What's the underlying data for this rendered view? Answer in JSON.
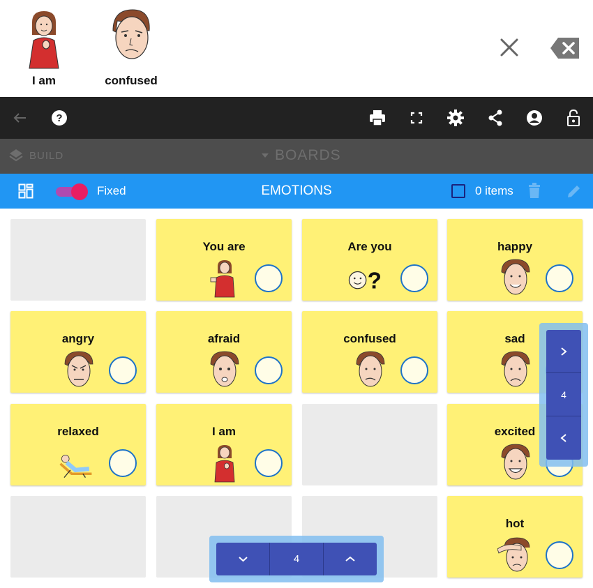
{
  "output": {
    "tiles": [
      {
        "label": "I am"
      },
      {
        "label": "confused"
      }
    ]
  },
  "navbar": {
    "icons": [
      "back-arrow-icon",
      "help-icon",
      "print-icon",
      "fullscreen-icon",
      "settings-icon",
      "share-icon",
      "account-icon",
      "lock-icon"
    ]
  },
  "buildbar": {
    "build_label": "BUILD",
    "boards_label": "BOARDS"
  },
  "boardbar": {
    "title": "EMOTIONS",
    "fixed_label": "Fixed",
    "items_label": "0 items"
  },
  "tiles": [
    {
      "label": ""
    },
    {
      "label": "You are"
    },
    {
      "label": "Are you"
    },
    {
      "label": "happy"
    },
    {
      "label": "angry"
    },
    {
      "label": "afraid"
    },
    {
      "label": "confused"
    },
    {
      "label": "sad"
    },
    {
      "label": "relaxed"
    },
    {
      "label": "I am"
    },
    {
      "label": ""
    },
    {
      "label": "excited"
    },
    {
      "label": ""
    },
    {
      "label": ""
    },
    {
      "label": ""
    },
    {
      "label": "hot"
    }
  ],
  "pager": {
    "vertical_page": "4",
    "horizontal_page": "4"
  },
  "colors": {
    "tile": "#fff176",
    "toolbar": "#2196f3",
    "navbar": "#222222",
    "pager": "#3f51b5"
  }
}
